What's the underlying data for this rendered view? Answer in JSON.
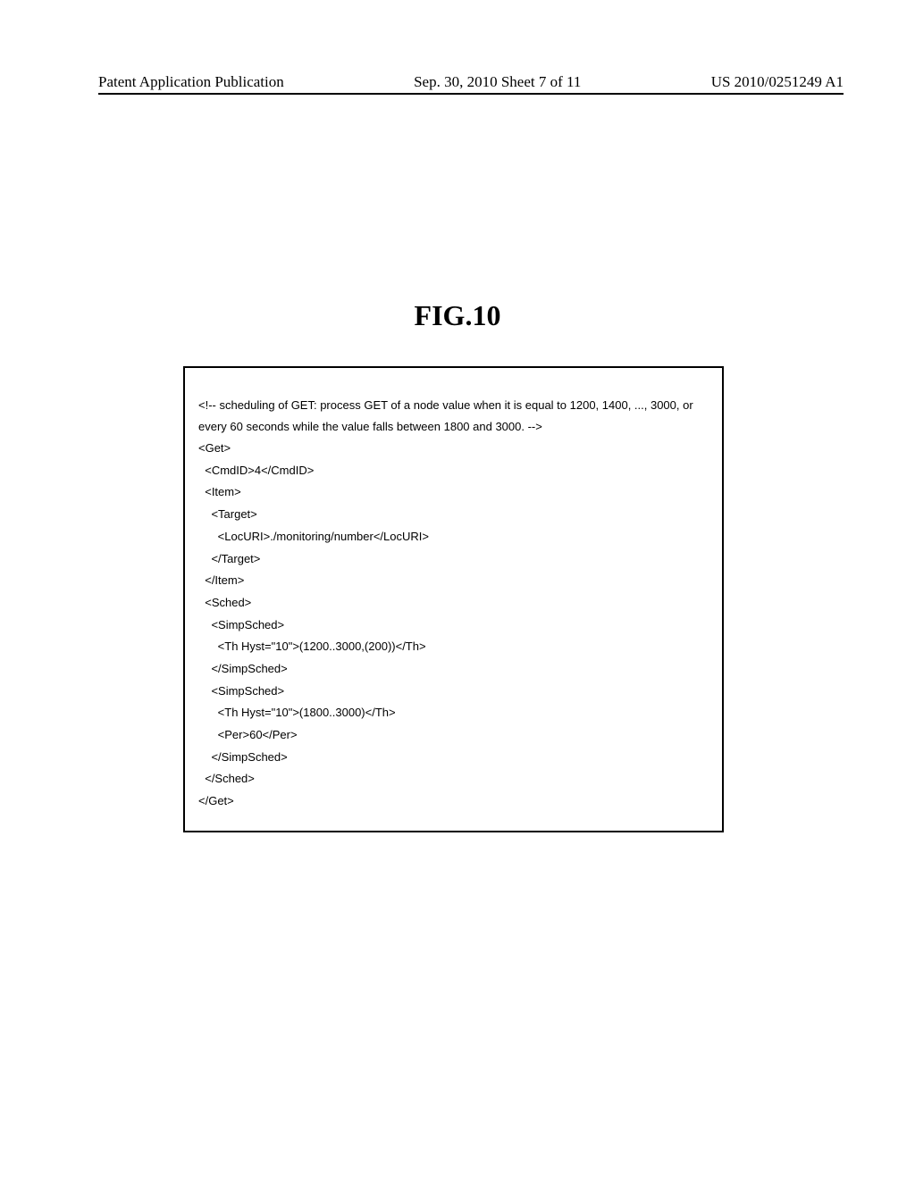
{
  "header": {
    "left": "Patent Application Publication",
    "center": "Sep. 30, 2010  Sheet 7 of 11",
    "right": "US 2010/0251249 A1"
  },
  "figure": {
    "title": "FIG.10"
  },
  "code": {
    "comment": "<!-- scheduling of GET: process GET of a node value when it is equal to 1200, 1400, ..., 3000, or every 60 seconds while the value falls between 1800 and 3000. -->",
    "lines": [
      "<Get>",
      "  <CmdID>4</CmdID>",
      "  <Item>",
      "    <Target>",
      "      <LocURI>./monitoring/number</LocURI>",
      "    </Target>",
      "  </Item>",
      "  <Sched>",
      "    <SimpSched>",
      "      <Th Hyst=\"10\">(1200..3000,(200))</Th>",
      "    </SimpSched>",
      "    <SimpSched>",
      "      <Th Hyst=\"10\">(1800..3000)</Th>",
      "      <Per>60</Per>",
      "    </SimpSched>",
      "  </Sched>",
      "</Get>"
    ]
  }
}
